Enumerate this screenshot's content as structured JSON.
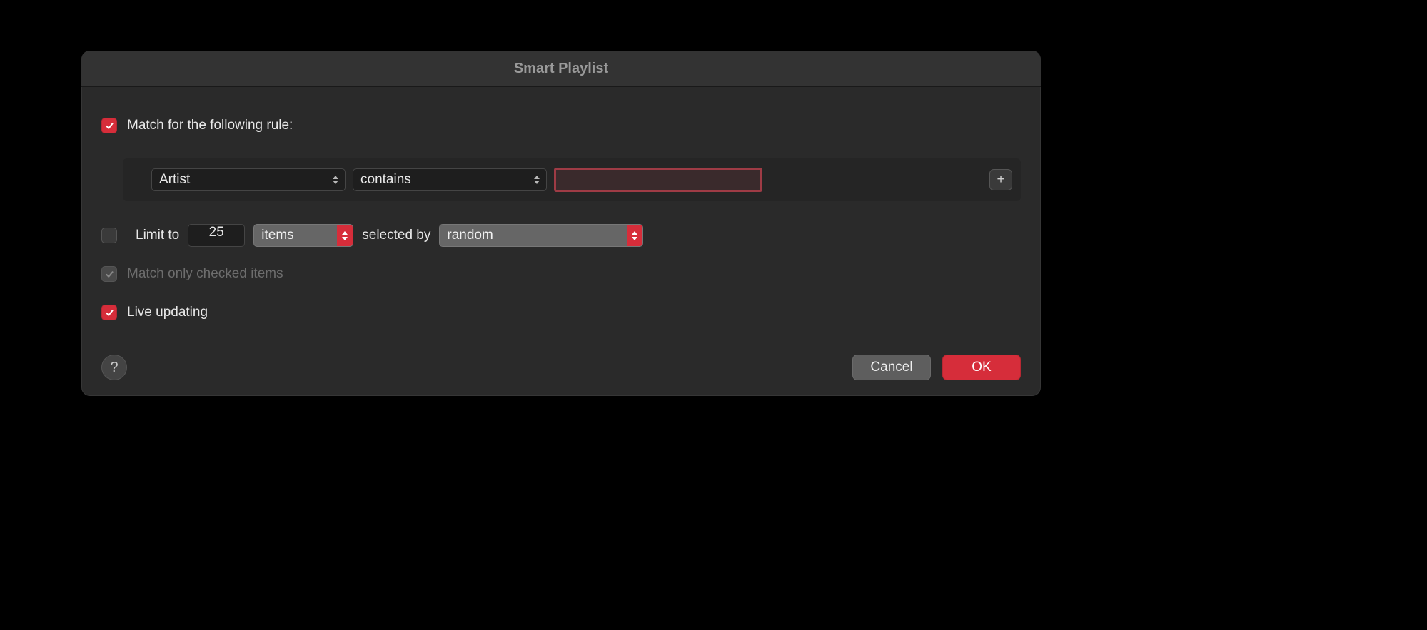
{
  "title": "Smart Playlist",
  "match_rule": {
    "checked": true,
    "label": "Match for the following rule:"
  },
  "rule": {
    "field": "Artist",
    "operator": "contains",
    "value": ""
  },
  "limit": {
    "checked": false,
    "label": "Limit to",
    "count": "25",
    "unit": "items",
    "selected_by_label": "selected by",
    "selected_by": "random"
  },
  "match_checked_items": {
    "checked": true,
    "disabled": true,
    "label": "Match only checked items"
  },
  "live_updating": {
    "checked": true,
    "label": "Live updating"
  },
  "footer": {
    "help": "?",
    "cancel": "Cancel",
    "ok": "OK"
  },
  "icons": {
    "plus": "+"
  }
}
